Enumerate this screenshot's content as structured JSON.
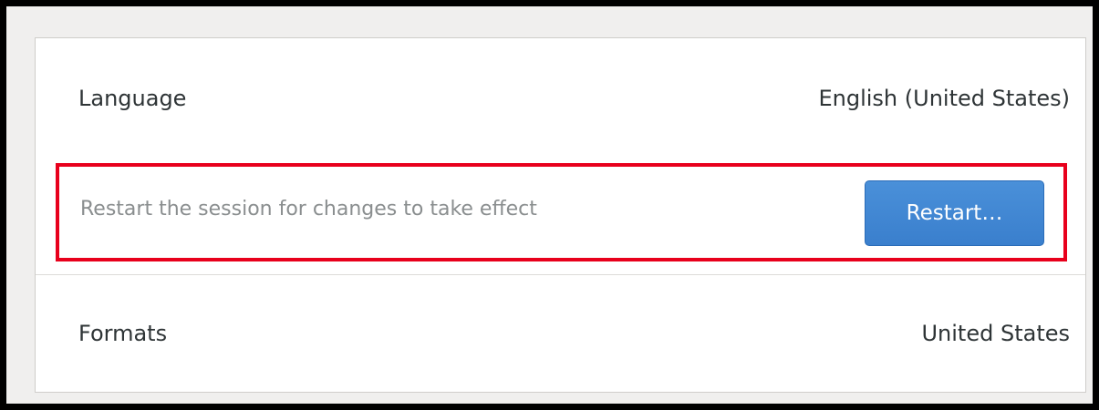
{
  "language": {
    "label": "Language",
    "value": "English (United States)"
  },
  "restart_notice": {
    "message": "Restart the session for changes to take effect",
    "button_label": "Restart…",
    "highlight_color": "#e8001c",
    "button_color": "#3a7fcd"
  },
  "formats": {
    "label": "Formats",
    "value": "United States"
  }
}
